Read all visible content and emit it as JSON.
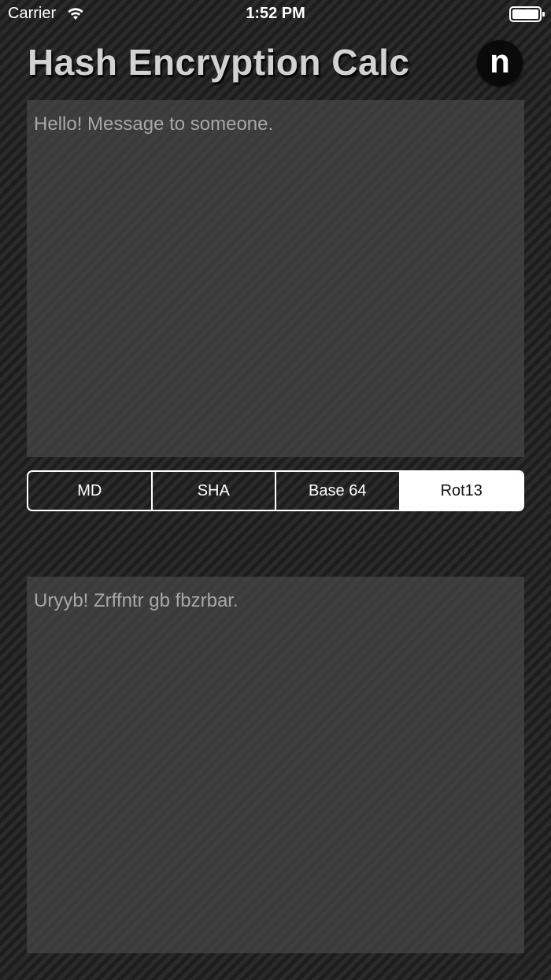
{
  "status_bar": {
    "carrier": "Carrier",
    "time": "1:52 PM",
    "wifi_icon": "wifi-icon",
    "battery_icon": "battery-full-icon"
  },
  "header": {
    "title": "Hash Encryption Calc",
    "n_button_label": "n"
  },
  "input": {
    "value": "Hello! Message to someone."
  },
  "modes": {
    "items": [
      {
        "label": "MD"
      },
      {
        "label": "SHA"
      },
      {
        "label": "Base 64"
      },
      {
        "label": "Rot13"
      }
    ],
    "selected": "Rot13"
  },
  "output": {
    "value": "Uryyb! Zrffntr gb fbzrbar."
  },
  "colors": {
    "background_stripe_light": "#2b2b2b",
    "background_stripe_dark": "#1d1d1d",
    "text_area_fill": "#464646",
    "text_area_text": "#a8a8a8",
    "segment_border": "#ffffff",
    "title_text": "#d2d2d2"
  }
}
